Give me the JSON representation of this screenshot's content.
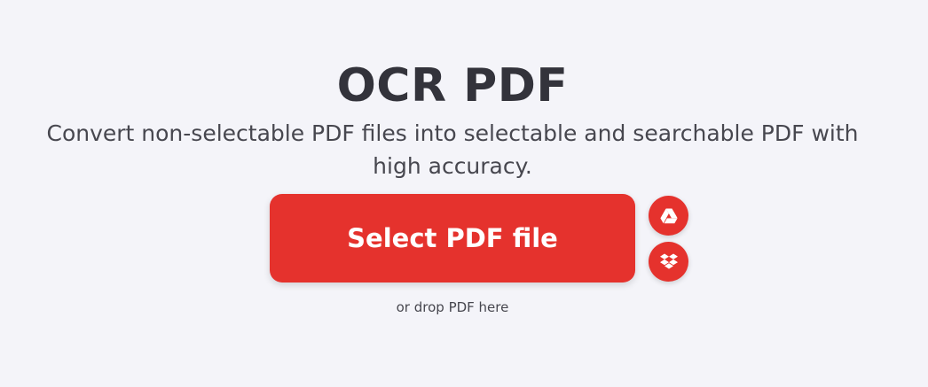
{
  "header": {
    "title": "OCR PDF",
    "subtitle": "Convert non-selectable PDF files into selectable and searchable PDF with high accuracy."
  },
  "upload": {
    "select_label": "Select PDF file",
    "drop_hint": "or drop PDF here",
    "cloud_sources": [
      {
        "name": "Google Drive",
        "icon": "google-drive-icon"
      },
      {
        "name": "Dropbox",
        "icon": "dropbox-icon"
      }
    ]
  },
  "colors": {
    "background": "#f4f4f9",
    "accent": "#e5322d",
    "text": "#33333b"
  }
}
